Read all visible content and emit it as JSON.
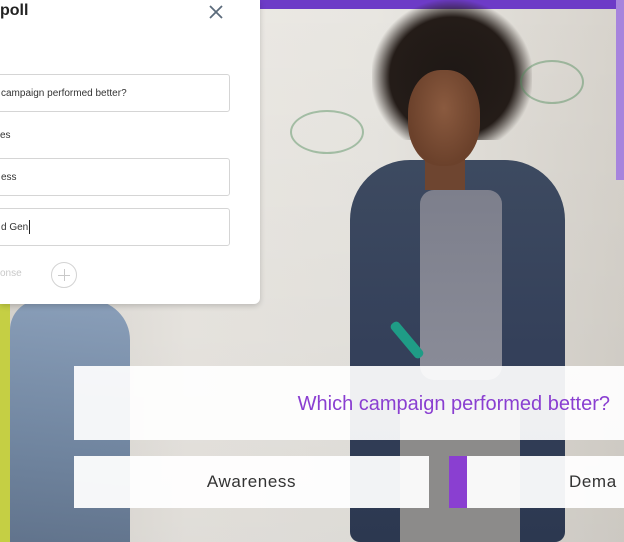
{
  "dialog": {
    "title": "poll",
    "question_value": "campaign performed better?",
    "responses_label": "es",
    "options": [
      "ess",
      "d Gen"
    ],
    "add_response_label": "onse"
  },
  "poll": {
    "question": "Which campaign performed better?",
    "option1": "Awareness",
    "option2": "Dema",
    "accent_color": "#8a3fd1"
  },
  "icons": {
    "close": "close-icon",
    "add": "plus-circle-icon"
  }
}
